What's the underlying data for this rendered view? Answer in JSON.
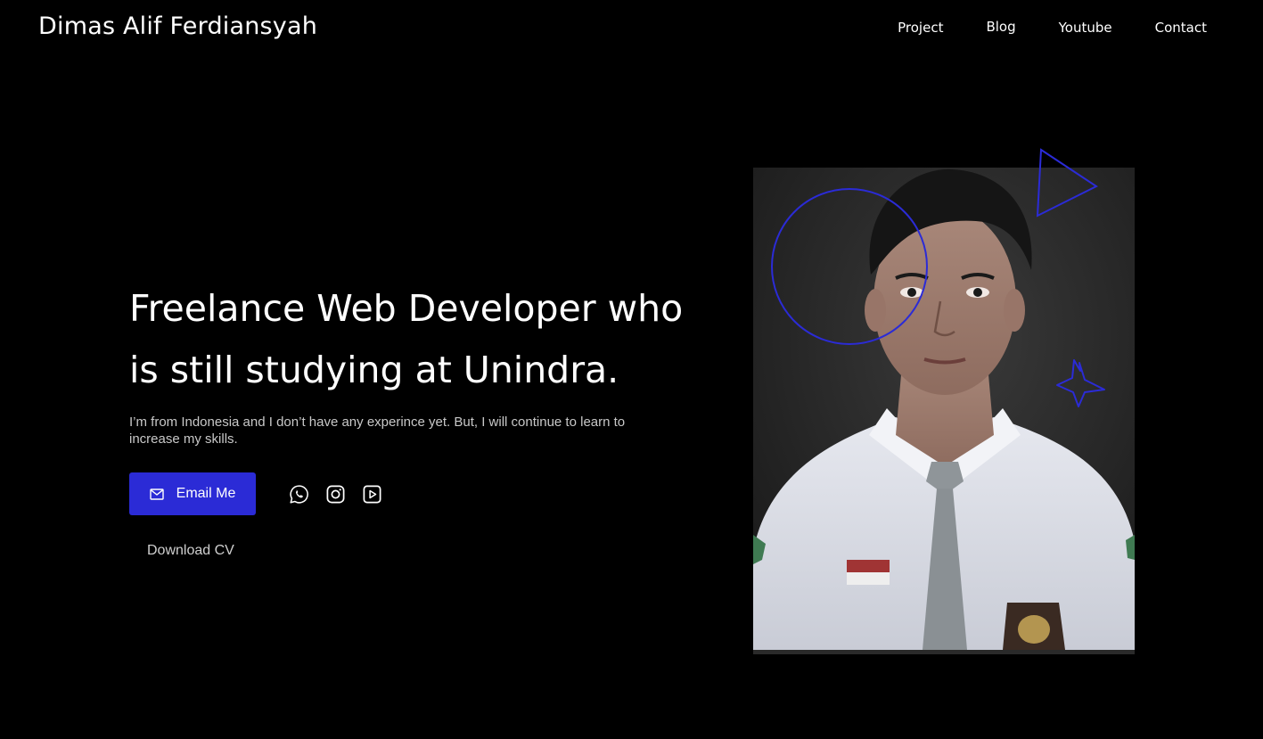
{
  "header": {
    "brand": "Dimas Alif Ferdiansyah",
    "nav": [
      "Project",
      "Blog",
      "Youtube",
      "Contact"
    ]
  },
  "hero": {
    "headline_line1": "Freelance Web Developer who",
    "headline_line2": "is still studying at Unindra.",
    "subtext": "I’m from Indonesia and I don’t have any experince yet. But, I will continue to learn to increase my skills.",
    "email_button": "Email Me",
    "download_cv": "Download CV"
  },
  "socials": [
    {
      "icon": "whatsapp-icon"
    },
    {
      "icon": "instagram-icon"
    },
    {
      "icon": "youtube-icon"
    }
  ],
  "colors": {
    "background": "#000000",
    "accent": "#2b2bd6",
    "text": "#ffffff",
    "muted_text": "#c8c8c8"
  }
}
